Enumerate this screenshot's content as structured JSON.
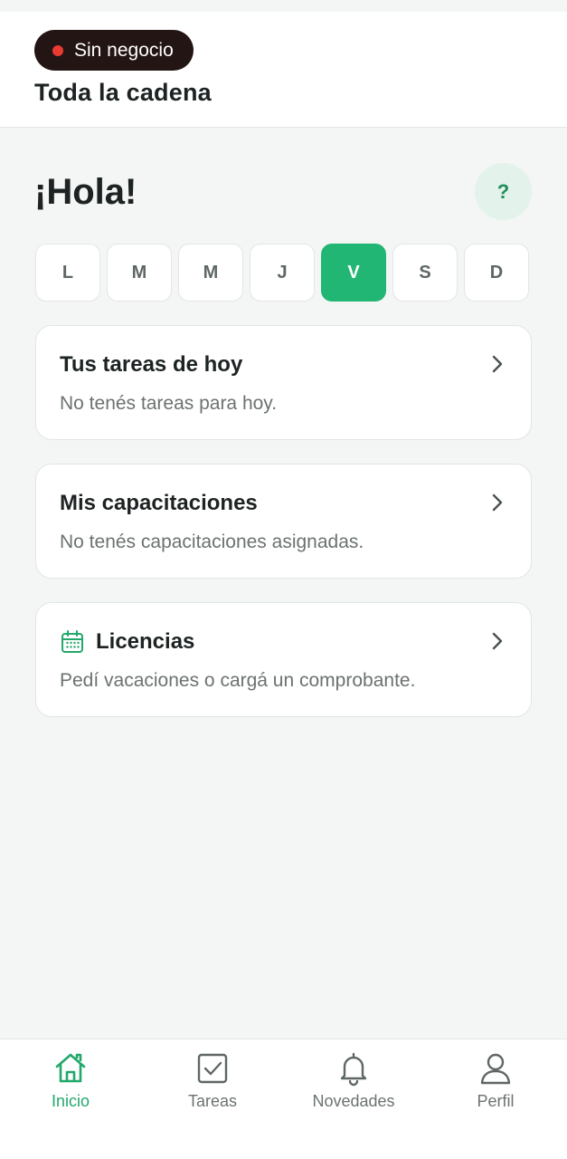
{
  "header": {
    "business_status": "Sin negocio",
    "chain_label": "Toda la cadena",
    "status_dot_color": "#ea3a31"
  },
  "greeting": "¡Hola!",
  "help_label": "?",
  "week_days": [
    {
      "label": "L",
      "active": false
    },
    {
      "label": "M",
      "active": false
    },
    {
      "label": "M",
      "active": false
    },
    {
      "label": "J",
      "active": false
    },
    {
      "label": "V",
      "active": true
    },
    {
      "label": "S",
      "active": false
    },
    {
      "label": "D",
      "active": false
    }
  ],
  "cards": {
    "tasks": {
      "title": "Tus tareas de hoy",
      "subtitle": "No tenés tareas para hoy."
    },
    "trainings": {
      "title": "Mis capacitaciones",
      "subtitle": "No tenés capacitaciones asignadas."
    },
    "licenses": {
      "title": "Licencias",
      "subtitle": "Pedí vacaciones o cargá un comprobante.",
      "icon": "calendar-icon"
    }
  },
  "bottom_nav": {
    "home": {
      "label": "Inicio",
      "icon": "home-icon",
      "active": true
    },
    "tasks": {
      "label": "Tareas",
      "icon": "checkbox-icon",
      "active": false
    },
    "news": {
      "label": "Novedades",
      "icon": "bell-icon",
      "active": false
    },
    "profile": {
      "label": "Perfil",
      "icon": "user-icon",
      "active": false
    }
  },
  "colors": {
    "accent": "#22b675",
    "pill_background": "#231513",
    "help_background": "#e3f2ea"
  }
}
